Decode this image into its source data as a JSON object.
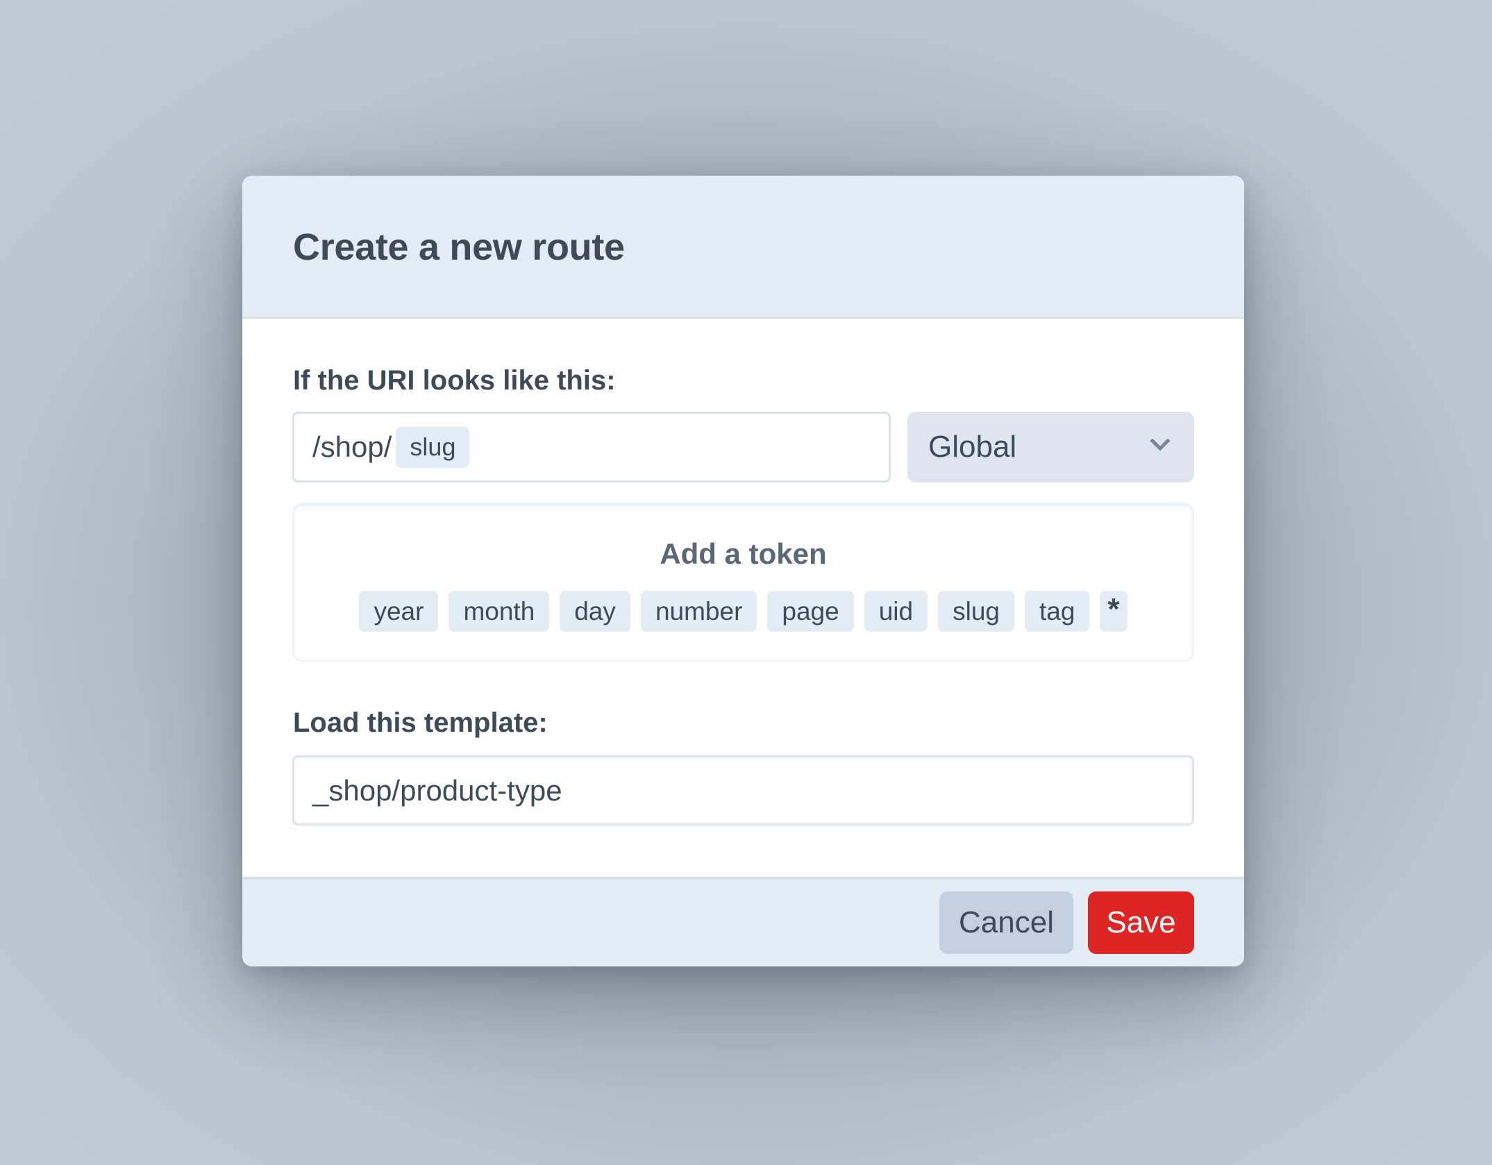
{
  "dialog": {
    "title": "Create a new route"
  },
  "uri_section": {
    "label": "If the URI looks like this:",
    "input": {
      "prefix": "/shop/",
      "token": "slug"
    },
    "site_select": {
      "value": "Global",
      "icon": "chevron-down-icon"
    }
  },
  "token_panel": {
    "title": "Add a token",
    "tokens": [
      "year",
      "month",
      "day",
      "number",
      "page",
      "uid",
      "slug",
      "tag",
      "*"
    ]
  },
  "template_section": {
    "label": "Load this template:",
    "value": "_shop/product-type"
  },
  "footer": {
    "cancel_label": "Cancel",
    "save_label": "Save"
  },
  "colors": {
    "header_bg": "#e3ebf5",
    "text": "#3d4b59",
    "chip_bg": "#e3ebf5",
    "select_bg": "#dee5ee",
    "cancel_bg": "#c3d0df",
    "save_bg": "#dc2626"
  }
}
